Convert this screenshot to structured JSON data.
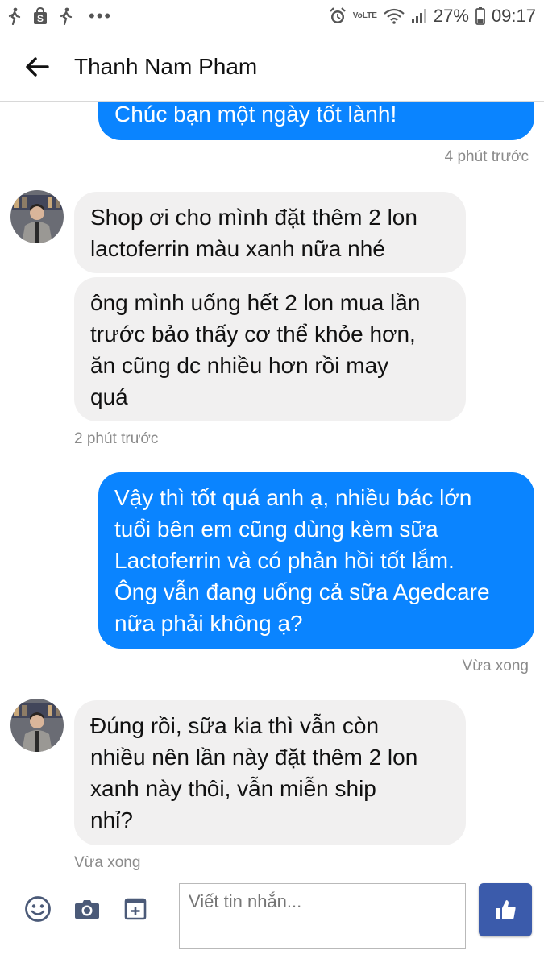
{
  "status_bar": {
    "battery": "27%",
    "time": "09:17",
    "icons": [
      "walk-icon",
      "shopee-icon",
      "walk-icon",
      "more-dots-icon",
      "alarm-icon",
      "volte-icon",
      "wifi-icon",
      "signal-icon",
      "battery-icon"
    ]
  },
  "header": {
    "title": "Thanh Nam Pham"
  },
  "messages": [
    {
      "direction": "outgoing",
      "text": "Chúc bạn một ngày tốt lành!"
    },
    {
      "direction": "timestamp",
      "text": "4 phút trước"
    },
    {
      "direction": "incoming",
      "lines": [
        "Shop ơi cho mình đặt thêm 2 lon",
        "lactoferrin màu xanh nữa nhé"
      ]
    },
    {
      "direction": "incoming",
      "lines": [
        "ông mình uống hết 2 lon mua lần",
        "trước bảo thấy cơ thể khỏe hơn,",
        "ăn cũng dc nhiều hơn rồi may",
        "quá"
      ]
    },
    {
      "direction": "timestamp",
      "text": "2 phút trước"
    },
    {
      "direction": "outgoing",
      "lines": [
        "Vậy thì tốt quá anh ạ, nhiều bác lớn",
        "tuổi bên em cũng dùng kèm sữa",
        "Lactoferrin và có phản hồi tốt lắm.",
        "Ông vẫn đang uống cả sữa Agedcare",
        "nữa phải không ạ?"
      ]
    },
    {
      "direction": "timestamp",
      "text": "Vừa xong"
    },
    {
      "direction": "incoming",
      "lines": [
        "Đúng rồi, sữa kia thì vẫn còn",
        "nhiều nên lần này đặt thêm 2 lon",
        "xanh này thôi, vẫn miễn ship",
        "nhỉ?"
      ]
    },
    {
      "direction": "timestamp",
      "text": "Vừa xong"
    }
  ],
  "composer": {
    "placeholder": "Viết tin nhắn...",
    "icons": [
      "emoji-icon",
      "camera-icon",
      "attach-icon",
      "like-icon"
    ]
  },
  "colors": {
    "outgoing_bubble": "#0a84ff",
    "incoming_bubble": "#f1f0f0",
    "like_button": "#3b5bab"
  }
}
